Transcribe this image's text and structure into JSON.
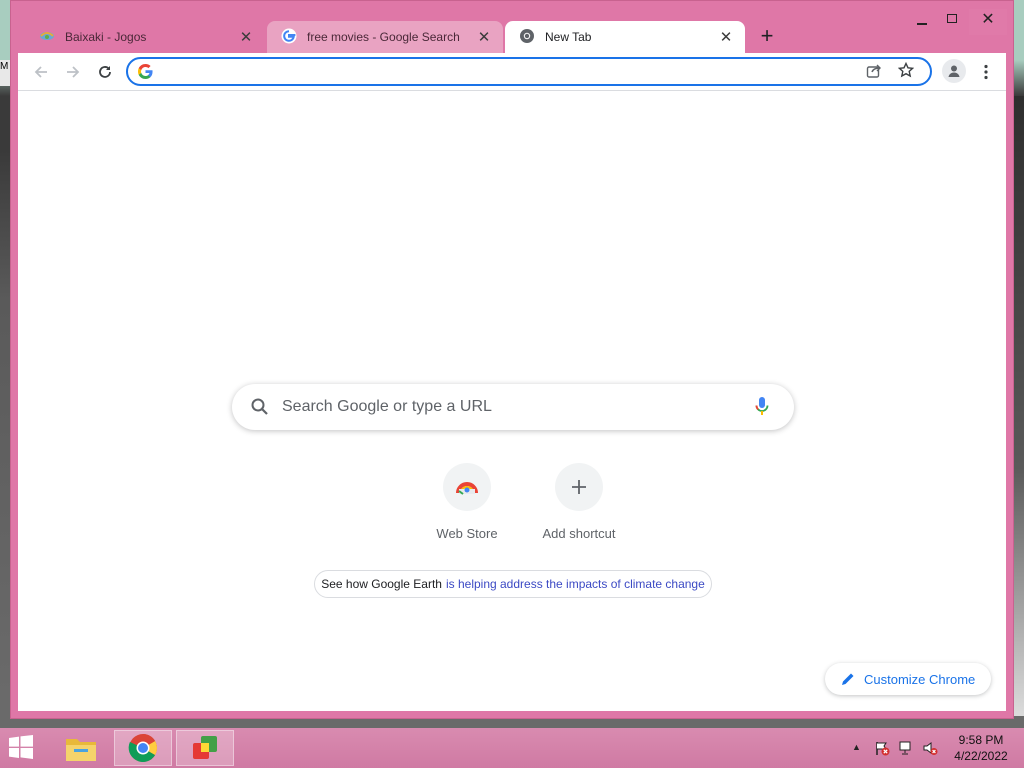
{
  "browser": {
    "tabs": [
      {
        "title": "Baixaki - Jogos",
        "icon": "baixaki-favicon",
        "active": false
      },
      {
        "title": "free movies - Google Search",
        "icon": "google-favicon",
        "active": false
      },
      {
        "title": "New Tab",
        "icon": "chrome-favicon",
        "active": true
      }
    ],
    "omnibox_value": "",
    "colors": {
      "frame": "#df77a7",
      "accent": "#1a73e8"
    }
  },
  "new_tab": {
    "search_placeholder": "Search Google or type a URL",
    "shortcuts": [
      {
        "label": "Web Store",
        "icon": "web-store-icon"
      },
      {
        "label": "Add shortcut",
        "icon": "plus-icon"
      }
    ],
    "promo": {
      "text": "See how Google Earth",
      "link": "is helping address the impacts of climate change"
    },
    "customize_label": "Customize Chrome"
  },
  "desktop": {
    "edge_text": "M"
  },
  "taskbar": {
    "time": "9:58 PM",
    "date": "4/22/2022"
  }
}
